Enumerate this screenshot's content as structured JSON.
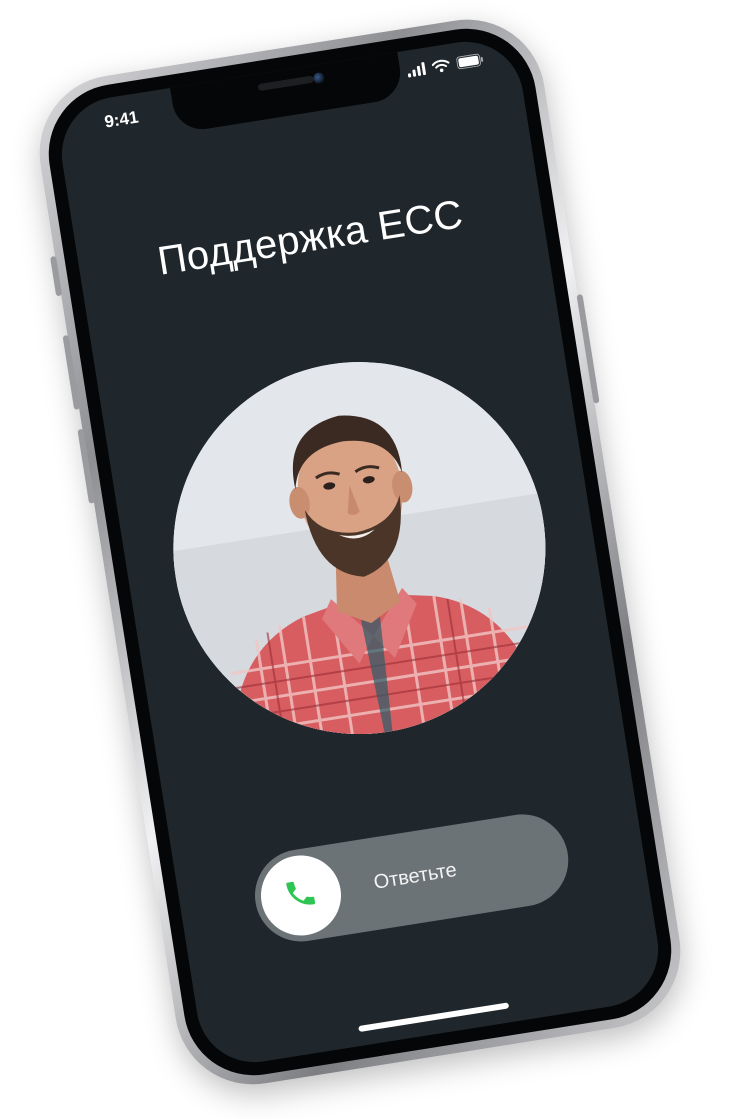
{
  "status_bar": {
    "time": "9:41",
    "signal_icon": "signal-bars-icon",
    "wifi_icon": "wifi-icon",
    "battery_icon": "battery-icon"
  },
  "call": {
    "caller_name": "Поддержка ЕСС",
    "avatar_description": "contact-avatar-photo",
    "answer_label": "Ответьте",
    "answer_icon": "phone-icon"
  },
  "colors": {
    "screen_bg": "#1f272c",
    "slider_bg": "#6c7376",
    "answer_green": "#2fc553",
    "text": "#ffffff"
  }
}
